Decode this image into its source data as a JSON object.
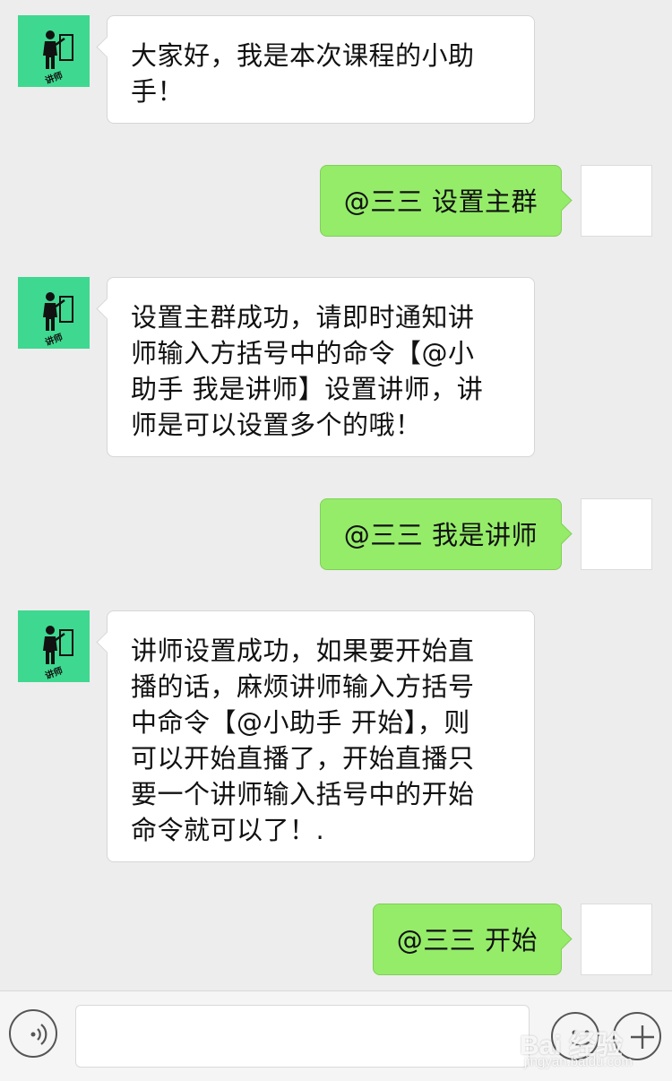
{
  "messages": [
    {
      "side": "left",
      "sender": "bot",
      "lines": [
        "大家好，我是本次课程的小助",
        "手！"
      ]
    },
    {
      "side": "right",
      "sender": "user",
      "text": "@三三 设置主群"
    },
    {
      "side": "left",
      "sender": "bot",
      "lines": [
        "设置主群成功，请即时通知讲",
        "师输入方括号中的命令【@小",
        "助手 我是讲师】设置讲师，讲",
        "师是可以设置多个的哦！"
      ]
    },
    {
      "side": "right",
      "sender": "user",
      "text": "@三三 我是讲师"
    },
    {
      "side": "left",
      "sender": "bot",
      "lines": [
        "讲师设置成功，如果要开始直",
        "播的话，麻烦讲师输入方括号",
        "中命令【@小助手 开始】，则",
        "可以开始直播了，开始直播只",
        "要一个讲师输入括号中的开始",
        "命令就可以了！."
      ]
    },
    {
      "side": "right",
      "sender": "user",
      "text": "@三三 开始"
    }
  ],
  "bot_avatar": {
    "label": "讲师",
    "bg_color": "#3fd890",
    "icon": "teacher-at-board-icon"
  },
  "input_bar": {
    "placeholder": "",
    "voice_icon": "voice-icon",
    "emoji_icon": "emoji-icon",
    "plus_icon": "plus-icon"
  },
  "watermark": {
    "text": "Bai 经验",
    "sub": "jingyan.baidu.com"
  },
  "colors": {
    "background": "#ededed",
    "bubble_self": "#95ec69",
    "bubble_other": "#ffffff"
  }
}
